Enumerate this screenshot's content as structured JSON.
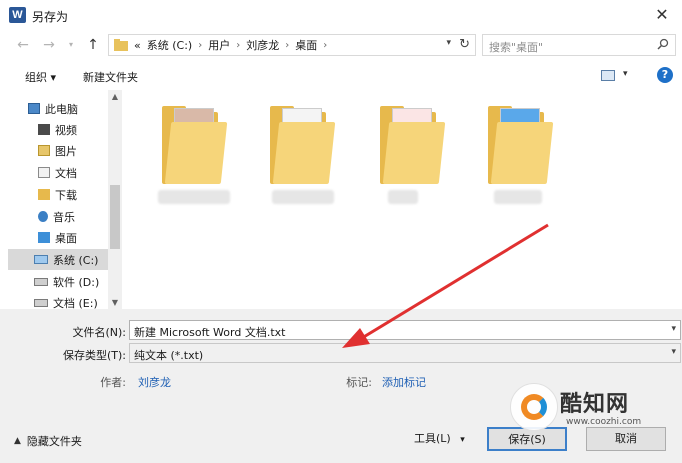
{
  "window": {
    "icon_letter": "W",
    "title": "另存为"
  },
  "nav": {
    "back_icon": "arrow-left",
    "forward_icon": "arrow-right",
    "recent_icon": "chevron-down",
    "up_icon": "arrow-up"
  },
  "address": {
    "overflow": "«",
    "crumbs": [
      "系统 (C:)",
      "用户",
      "刘彦龙",
      "桌面"
    ]
  },
  "search": {
    "placeholder": "搜索\"桌面\""
  },
  "toolbar": {
    "organize": "组织 ▾",
    "new_folder": "新建文件夹"
  },
  "sidebar": {
    "items": [
      {
        "label": "此电脑",
        "icon": "pc-icon",
        "selected": false
      },
      {
        "label": "视频",
        "icon": "video-icon",
        "selected": false
      },
      {
        "label": "图片",
        "icon": "pictures-icon",
        "selected": false
      },
      {
        "label": "文档",
        "icon": "documents-icon",
        "selected": false
      },
      {
        "label": "下载",
        "icon": "download-icon",
        "selected": false
      },
      {
        "label": "音乐",
        "icon": "music-icon",
        "selected": false
      },
      {
        "label": "桌面",
        "icon": "desktop-icon",
        "selected": false
      },
      {
        "label": "系统 (C:)",
        "icon": "drive-c-icon",
        "selected": true
      },
      {
        "label": "软件 (D:)",
        "icon": "drive-icon",
        "selected": false
      },
      {
        "label": "文档 (E:)",
        "icon": "drive-icon",
        "selected": false
      }
    ]
  },
  "form": {
    "filename_label": "文件名(N):",
    "filename_value": "新建 Microsoft Word 文档.txt",
    "filetype_label": "保存类型(T):",
    "filetype_value": "纯文本 (*.txt)",
    "author_label": "作者:",
    "author_value": "刘彦龙",
    "tags_label": "标记:",
    "tags_value": "添加标记",
    "hide_folders": "隐藏文件夹",
    "tools": "工具(L)",
    "save_button": "保存(S)",
    "cancel_button": "取消"
  },
  "watermark": {
    "brand": "酷知网",
    "url": "www.coozhi.com"
  },
  "colors": {
    "accent": "#1e70c8",
    "arrow": "#e03030",
    "folder": "#e7b94c"
  }
}
